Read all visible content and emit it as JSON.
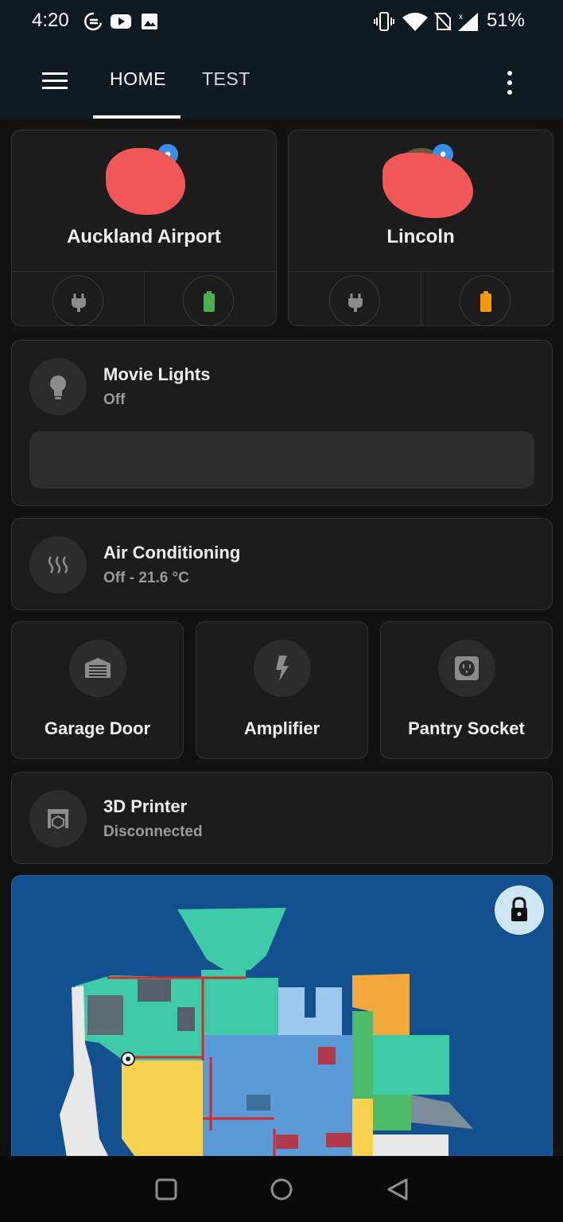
{
  "status_bar": {
    "time": "4:20",
    "battery": "51%",
    "icons": [
      "data-saver-icon",
      "youtube-icon",
      "image-icon",
      "vibrate-icon",
      "wifi-icon",
      "no-sim-icon",
      "signal-icon"
    ]
  },
  "app_bar": {
    "tabs": [
      {
        "label": "HOME",
        "active": true
      },
      {
        "label": "TEST",
        "active": false
      }
    ]
  },
  "people": [
    {
      "name": "Auckland Airport",
      "charging_icon": "plug-icon",
      "battery_icon": "battery-icon",
      "battery_color": "#4caf50"
    },
    {
      "name": "Lincoln",
      "charging_icon": "plug-icon",
      "battery_icon": "battery-icon",
      "battery_color": "#ff9800"
    }
  ],
  "movie_lights": {
    "name": "Movie Lights",
    "state": "Off",
    "icon": "lightbulb-icon"
  },
  "air_conditioning": {
    "name": "Air Conditioning",
    "state": "Off - 21.6 °C",
    "icon": "heat-wave-icon"
  },
  "buttons": [
    {
      "name": "Garage Door",
      "icon": "garage-icon"
    },
    {
      "name": "Amplifier",
      "icon": "flash-icon"
    },
    {
      "name": "Pantry Socket",
      "icon": "power-socket-icon"
    }
  ],
  "printer": {
    "name": "3D Printer",
    "state": "Disconnected",
    "icon": "printer-3d-icon"
  },
  "map": {
    "lock_icon": "lock-icon"
  },
  "colors": {
    "background": "#111111",
    "card": "#1c1c1c",
    "app_bar": "#0f1a20",
    "map_background": "#12508f"
  }
}
